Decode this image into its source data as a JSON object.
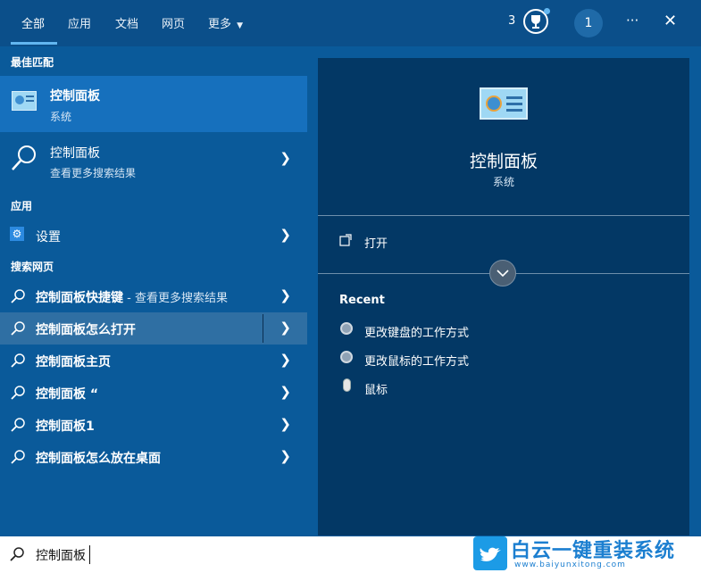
{
  "tabs": [
    "全部",
    "应用",
    "文档",
    "网页",
    "更多"
  ],
  "header": {
    "badge_count": "3",
    "account_initial": "1",
    "more_label": "···",
    "close_label": "✕"
  },
  "left": {
    "best_match_heading": "最佳匹配",
    "best_match": {
      "title": "控制面板",
      "subtitle": "系统"
    },
    "web_search_item": {
      "title": "控制面板",
      "subtitle": "查看更多搜索结果"
    },
    "apps_heading": "应用",
    "apps": [
      {
        "label": "设置"
      }
    ],
    "web_heading": "搜索网页",
    "web_results": [
      {
        "title": "控制面板快捷键",
        "suffix": " - 查看更多搜索结果"
      },
      {
        "title": "控制面板怎么打开",
        "suffix": ""
      },
      {
        "title": "控制面板主页",
        "suffix": ""
      },
      {
        "title": "控制面板 “",
        "suffix": ""
      },
      {
        "title": "控制面板1",
        "suffix": ""
      },
      {
        "title": "控制面板怎么放在桌面",
        "suffix": ""
      }
    ]
  },
  "preview": {
    "title": "控制面板",
    "subtitle": "系统",
    "open_label": "打开",
    "recent_heading": "Recent",
    "recent_items": [
      "更改键盘的工作方式",
      "更改鼠标的工作方式",
      "鼠标"
    ]
  },
  "search": {
    "value": "控制面板"
  },
  "watermark": {
    "brand": "白云一键重装系统",
    "url": "www.baiyunxitong.com"
  }
}
